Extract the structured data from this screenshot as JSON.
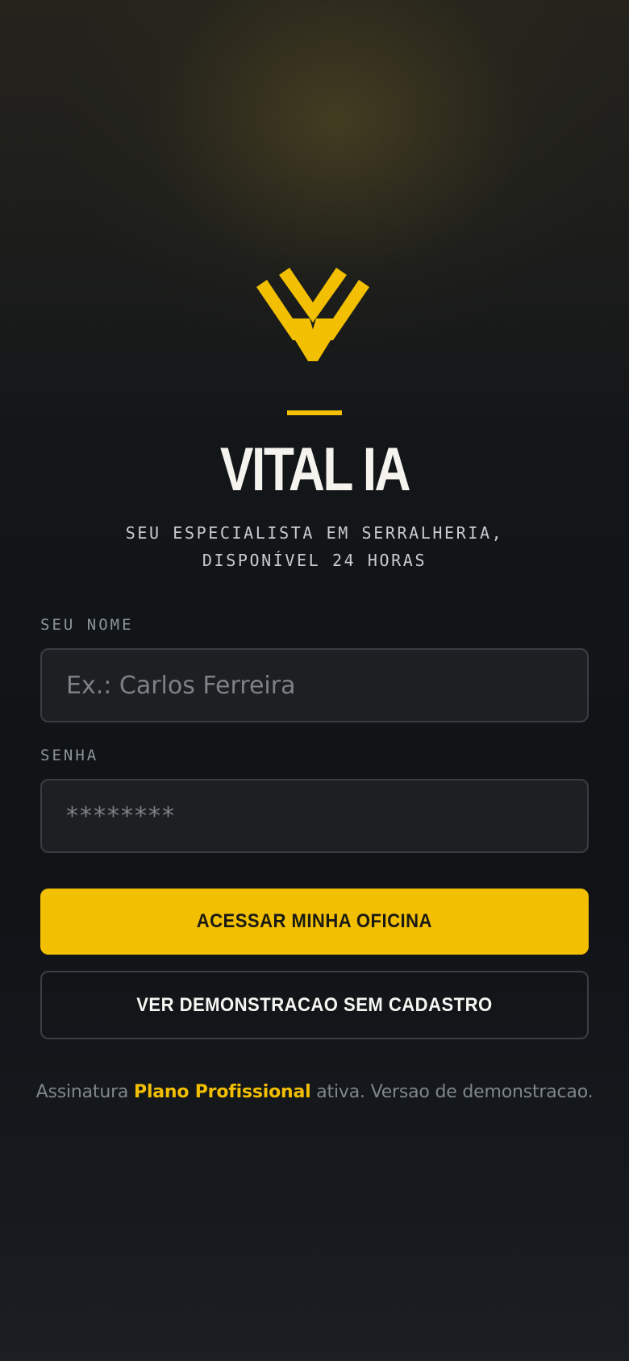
{
  "brand": {
    "logo_icon": "vital-ia-v-logo-icon",
    "name": "VITAL IA",
    "tagline_line1": "SEU ESPECIALISTA EM SERRALHERIA,",
    "tagline_line2": "DISPONÍVEL 24 HORAS"
  },
  "form": {
    "name_label": "SEU NOME",
    "name_placeholder": "Ex.: Carlos Ferreira",
    "password_label": "SENHA",
    "password_placeholder": "********"
  },
  "actions": {
    "primary_label": "ACESSAR MINHA OFICINA",
    "secondary_label": "VER DEMONSTRACAO SEM CADASTRO"
  },
  "footer": {
    "prefix": "Assinatura ",
    "plan": "Plano Profissional",
    "suffix": " ativa. Versao de demonstracao."
  },
  "colors": {
    "accent": "#f2bf02",
    "background": "#101316",
    "input_background": "#1e1f22"
  }
}
